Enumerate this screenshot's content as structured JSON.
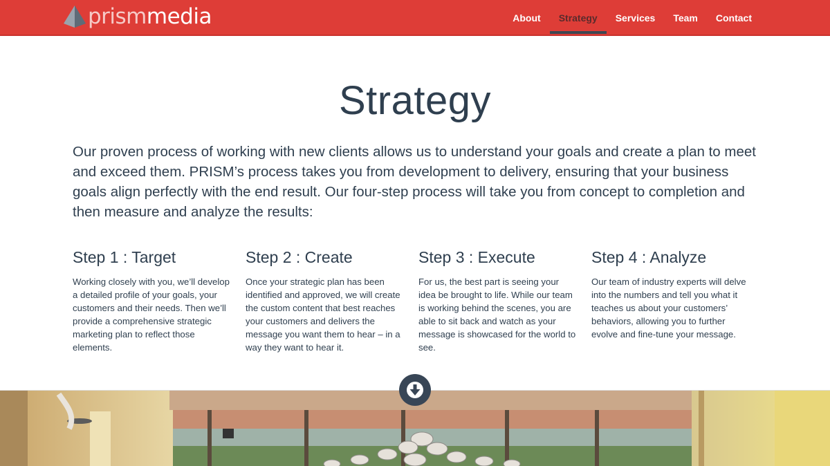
{
  "brand": {
    "part_a": "prism",
    "part_b": "media"
  },
  "nav": {
    "items": [
      {
        "label": "About",
        "active": false
      },
      {
        "label": "Strategy",
        "active": true
      },
      {
        "label": "Services",
        "active": false
      },
      {
        "label": "Team",
        "active": false
      },
      {
        "label": "Contact",
        "active": false
      }
    ]
  },
  "page": {
    "title": "Strategy",
    "intro": "Our proven process of working with new clients allows us to understand your goals and create a plan to meet and exceed them. PRISM’s process takes you from development to delivery, ensuring that your business goals align perfectly with the end result. Our four-step process will take you from concept to completion and then measure and analyze the results:"
  },
  "steps": [
    {
      "title": "Step 1 : Target",
      "body": "Working closely with you, we’ll develop a detailed profile of your goals, your customers and their needs. Then we’ll provide a comprehensive strategic marketing plan to reflect those elements."
    },
    {
      "title": "Step 2 : Create",
      "body": "Once your strategic plan has been identified and approved, we will create the custom content that best reaches your customers and delivers the message you want them to hear – in a way they want to hear it."
    },
    {
      "title": "Step 3 : Execute",
      "body": "For us, the best part is seeing your idea be brought to life. While our team is working behind the scenes, you are able to sit back and watch as your message is showcased for the world to see."
    },
    {
      "title": "Step 4 : Analyze",
      "body": "Our team of industry experts will delve into the numbers and tell you what it teaches us about your customers’ behaviors, allowing you to further evolve and fine-tune your message."
    }
  ],
  "icons": {
    "scroll": "arrow-down-circle-icon",
    "logo": "prism-pyramid-icon"
  },
  "colors": {
    "nav_bg": "#de3d37",
    "text": "#2f3f4f",
    "accent_dark": "#384656"
  }
}
